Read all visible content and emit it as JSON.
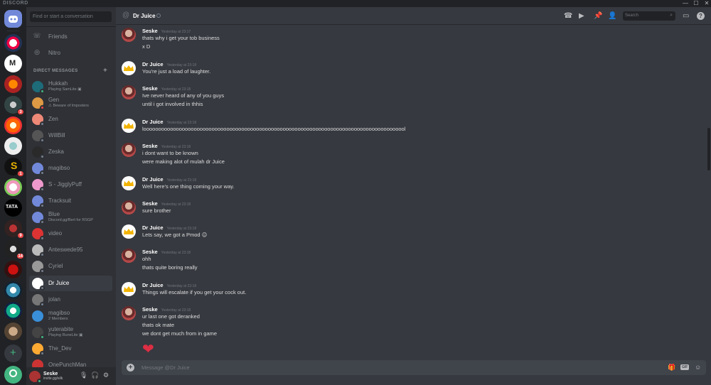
{
  "app": {
    "brand": "DISCORD",
    "window_controls": [
      "—",
      "☐",
      "✕"
    ]
  },
  "servers": [
    {
      "name": "home",
      "badge": ""
    },
    {
      "name": "server-1",
      "badge": ""
    },
    {
      "name": "server-2",
      "badge": ""
    },
    {
      "name": "server-3",
      "badge": ""
    },
    {
      "name": "server-4",
      "badge": "3"
    },
    {
      "name": "server-5",
      "badge": ""
    },
    {
      "name": "server-6",
      "badge": ""
    },
    {
      "name": "server-7",
      "badge": "1"
    },
    {
      "name": "server-8",
      "badge": ""
    },
    {
      "name": "server-9",
      "badge": ""
    },
    {
      "name": "server-10",
      "badge": "9"
    },
    {
      "name": "server-11",
      "badge": "14"
    },
    {
      "name": "server-12",
      "badge": ""
    },
    {
      "name": "server-13",
      "badge": ""
    },
    {
      "name": "server-14",
      "badge": ""
    },
    {
      "name": "server-15",
      "badge": ""
    }
  ],
  "sidebar": {
    "search_placeholder": "Find or start a conversation",
    "friends": "Friends",
    "nitro": "Nitro",
    "dm_header": "DIRECT MESSAGES",
    "dms": [
      {
        "name": "Hukkah",
        "sub": "Playing SamLite ▣",
        "status": "on"
      },
      {
        "name": "Gen",
        "sub": "⚠ Beware of Imposters",
        "status": "dnd"
      },
      {
        "name": "Zen",
        "sub": "",
        "status": "off"
      },
      {
        "name": "WillBill",
        "sub": "",
        "status": "off"
      },
      {
        "name": "Zeska",
        "sub": "",
        "status": "off"
      },
      {
        "name": "magibso",
        "sub": "",
        "status": "off"
      },
      {
        "name": "S - JigglyPuff",
        "sub": "",
        "status": "off"
      },
      {
        "name": "Tracksuit",
        "sub": "",
        "status": "off"
      },
      {
        "name": "Blue",
        "sub": "Discord.gg/Bert for RSGP",
        "status": "off"
      },
      {
        "name": "video",
        "sub": "",
        "status": "off"
      },
      {
        "name": "Anteswede95",
        "sub": "",
        "status": "off"
      },
      {
        "name": "Cyriel",
        "sub": "",
        "status": "off"
      },
      {
        "name": "Dr Juice",
        "sub": "",
        "status": "off"
      },
      {
        "name": "jolan",
        "sub": "",
        "status": "off"
      },
      {
        "name": "magibso",
        "sub": "2 Members",
        "status": "none"
      },
      {
        "name": "yuterabite",
        "sub": "Playing RuneLite ▣",
        "status": "on"
      },
      {
        "name": "The_Dev",
        "sub": "",
        "status": "off"
      },
      {
        "name": "OnePunchMan",
        "sub": "",
        "status": "off"
      }
    ]
  },
  "user": {
    "name": "Seske",
    "tag": "invite.gg/silk"
  },
  "chat": {
    "title": "Dr Juice",
    "header_search": "Search",
    "composer_placeholder": "Message @Dr Juice",
    "gif": "GIF",
    "messages": [
      {
        "author": "Seske",
        "time": "Yesterday at 23:17",
        "lines": [
          "thats why i get your tob business",
          "x D"
        ]
      },
      {
        "author": "Dr Juice",
        "time": "Yesterday at 23:18",
        "lines": [
          "You're just a load of laughter."
        ]
      },
      {
        "author": "Seske",
        "time": "Yesterday at 23:18",
        "lines": [
          "Ive never heard of any of you guys",
          "until i got involved in thhis"
        ]
      },
      {
        "author": "Dr Juice",
        "time": "Yesterday at 23:18",
        "lines": [
          "looooooooooooooooooooooooooooooooooooooooooooooooooooooooooooooooooooooooooooooooooooooool"
        ]
      },
      {
        "author": "Seske",
        "time": "Yesterday at 23:18",
        "lines": [
          "i dont want to be known",
          "were making alot of mulah dr Juice"
        ]
      },
      {
        "author": "Dr Juice",
        "time": "Yesterday at 23:18",
        "lines": [
          "Well here's one thing coming your way."
        ]
      },
      {
        "author": "Seske",
        "time": "Yesterday at 23:18",
        "lines": [
          "sure brother"
        ]
      },
      {
        "author": "Dr Juice",
        "time": "Yesterday at 23:18",
        "lines": [
          "Lets say, we got a Pmod 😉"
        ]
      },
      {
        "author": "Seske",
        "time": "Yesterday at 23:18",
        "lines": [
          "ohh",
          "thats quite boring really"
        ]
      },
      {
        "author": "Dr Juice",
        "time": "Yesterday at 23:18",
        "lines": [
          "Things will escalate if you get your cock out."
        ]
      },
      {
        "author": "Seske",
        "time": "Yesterday at 23:18",
        "lines": [
          "ur last one got deranked",
          "thats ok mate",
          "we dont get much from in game",
          "❤"
        ]
      }
    ]
  },
  "colors": {
    "background": "#36393f",
    "sidebar": "#2f3136",
    "rail": "#202225",
    "accent": "#7289da",
    "online": "#43b581",
    "dnd": "#f04747"
  }
}
